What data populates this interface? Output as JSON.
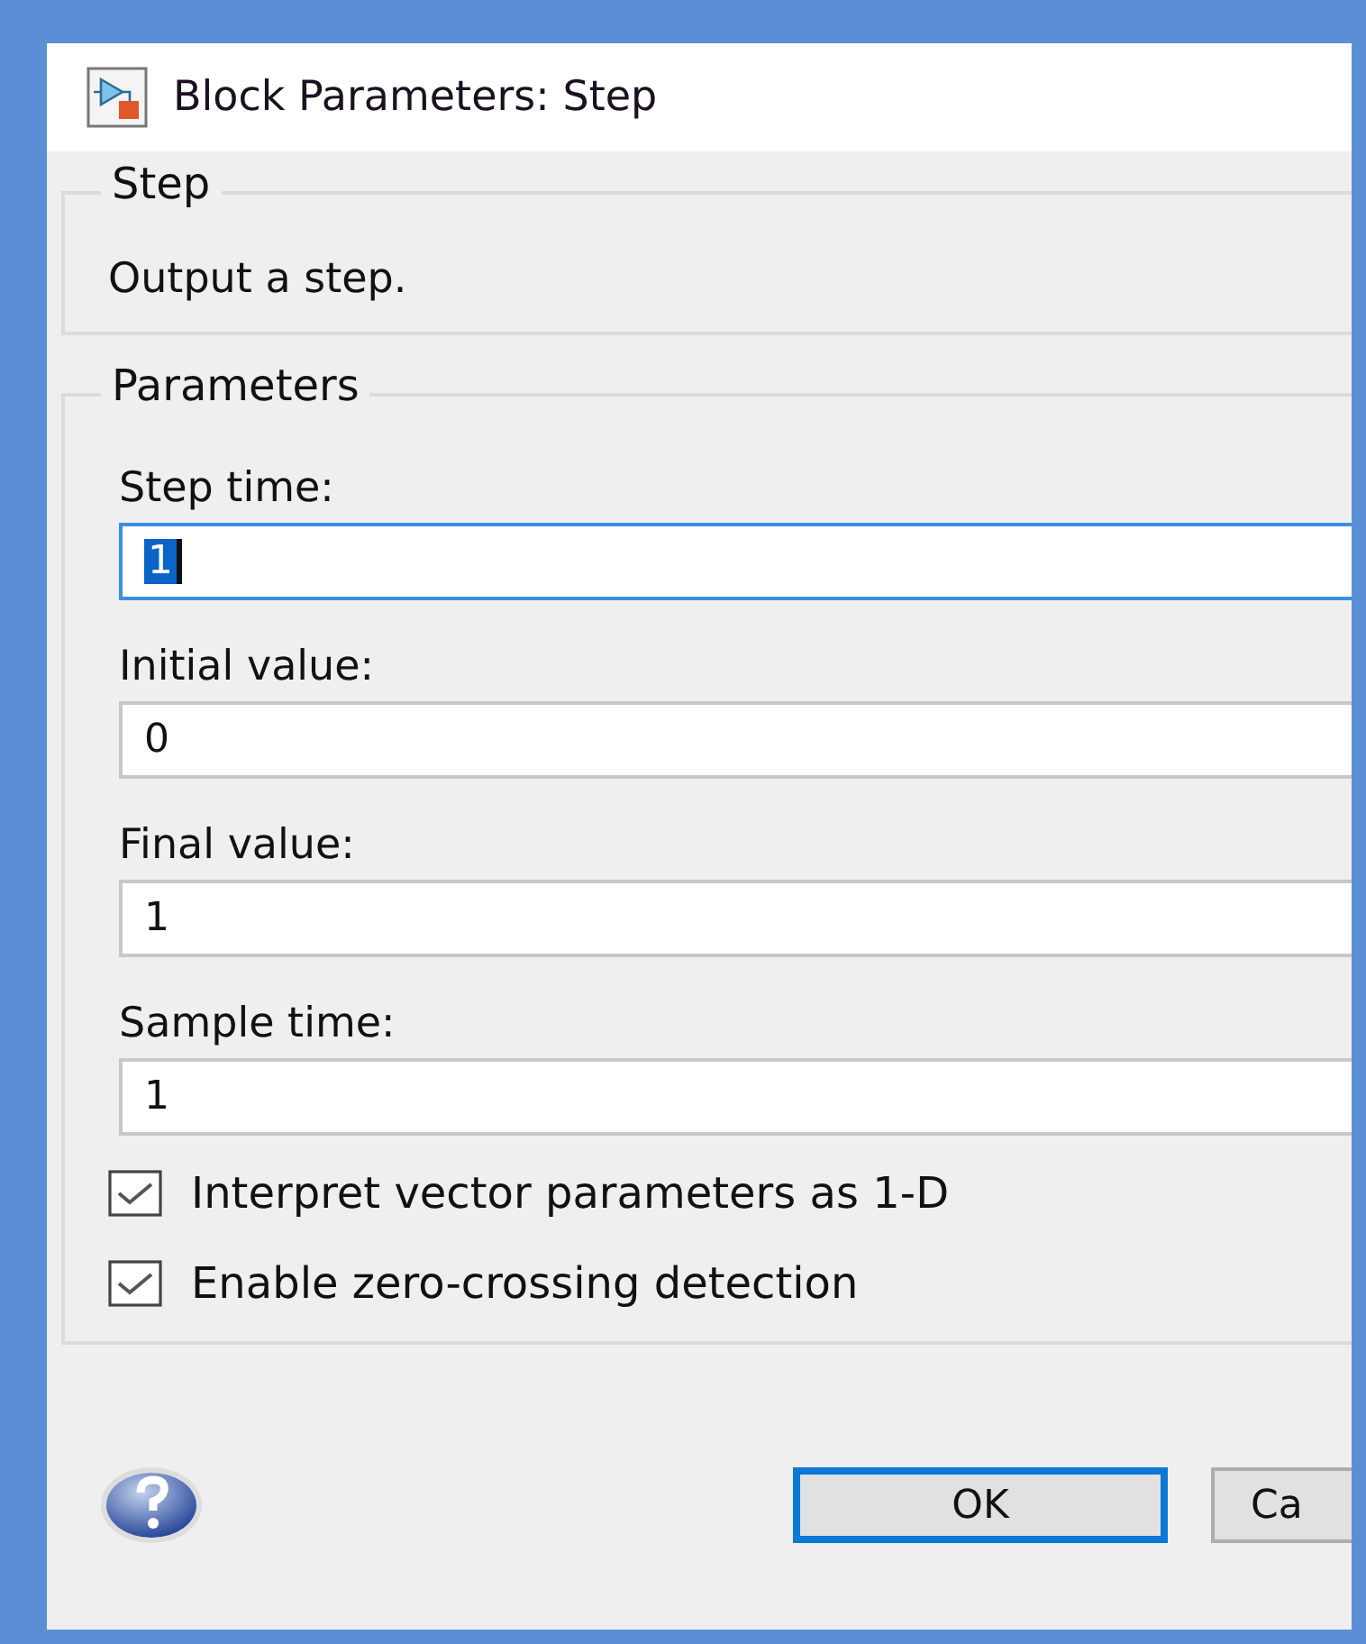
{
  "window": {
    "title": "Block Parameters: Step"
  },
  "description_group": {
    "legend": "Step",
    "text": "Output a step."
  },
  "parameters_group": {
    "legend": "Parameters",
    "fields": [
      {
        "label": "Step time:",
        "value": "1",
        "text_selected": true
      },
      {
        "label": "Initial value:",
        "value": "0",
        "text_selected": false
      },
      {
        "label": "Final value:",
        "value": "1",
        "text_selected": false
      },
      {
        "label": "Sample time:",
        "value": "1",
        "text_selected": false
      }
    ],
    "checkboxes": [
      {
        "label": "Interpret vector parameters as 1-D",
        "checked": true
      },
      {
        "label": "Enable zero-crossing detection",
        "checked": true
      }
    ]
  },
  "buttons": [
    {
      "label": "OK",
      "focused": true
    },
    {
      "label": "Ca",
      "focused": false
    }
  ]
}
